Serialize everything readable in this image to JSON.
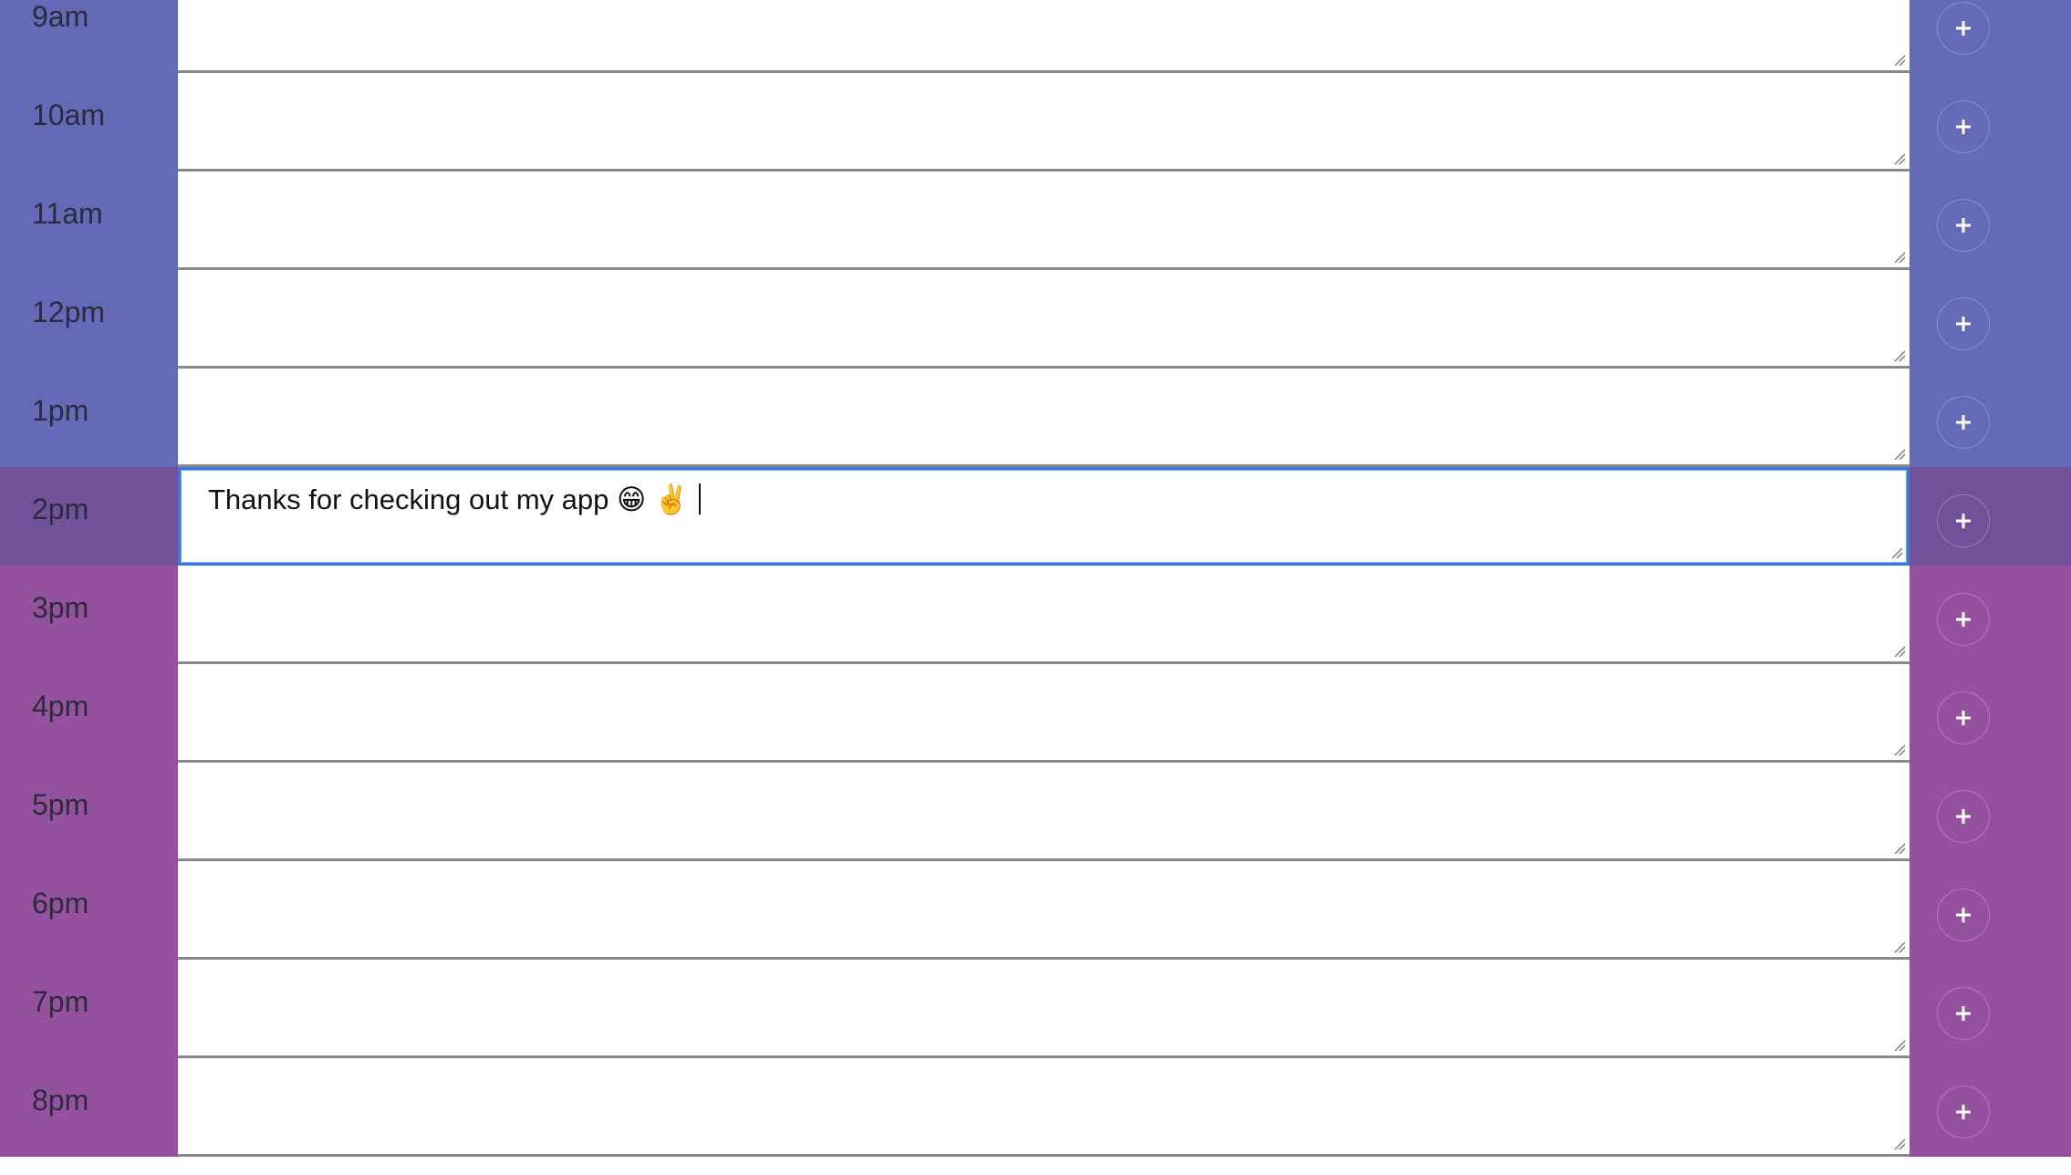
{
  "colors": {
    "past": "#6469b8",
    "present": "#73509a",
    "future": "#94529e",
    "focus_border": "#3a78e0"
  },
  "hours": [
    {
      "label": "9am",
      "state": "past",
      "text": ""
    },
    {
      "label": "10am",
      "state": "past",
      "text": ""
    },
    {
      "label": "11am",
      "state": "past",
      "text": ""
    },
    {
      "label": "12pm",
      "state": "past",
      "text": ""
    },
    {
      "label": "1pm",
      "state": "past",
      "text": ""
    },
    {
      "label": "2pm",
      "state": "present",
      "text": "Thanks for checking out my app 😁 ✌️",
      "focused": true
    },
    {
      "label": "3pm",
      "state": "future",
      "text": ""
    },
    {
      "label": "4pm",
      "state": "future",
      "text": ""
    },
    {
      "label": "5pm",
      "state": "future",
      "text": ""
    },
    {
      "label": "6pm",
      "state": "future",
      "text": ""
    },
    {
      "label": "7pm",
      "state": "future",
      "text": ""
    },
    {
      "label": "8pm",
      "state": "future",
      "text": ""
    }
  ],
  "save_icon": "plus-icon"
}
